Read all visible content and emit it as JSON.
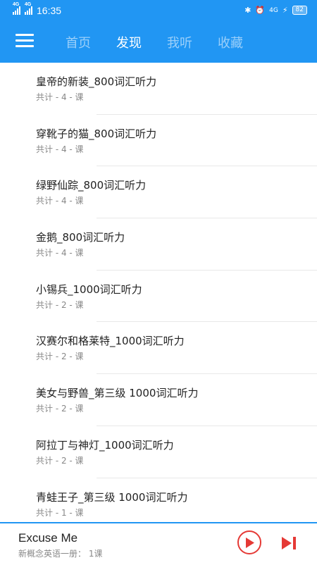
{
  "status_bar": {
    "signal1": "4G",
    "signal2": "4G",
    "time": "16:35",
    "right_network": "4G",
    "battery": "82"
  },
  "nav": {
    "tabs": [
      {
        "label": "首页",
        "active": false
      },
      {
        "label": "发现",
        "active": true
      },
      {
        "label": "我听",
        "active": false
      },
      {
        "label": "收藏",
        "active": false
      }
    ]
  },
  "list": {
    "items": [
      {
        "title": "皇帝的新装_800词汇听力",
        "subtitle": "共计 - 4 - 课"
      },
      {
        "title": "穿靴子的猫_800词汇听力",
        "subtitle": "共计 - 4 - 课"
      },
      {
        "title": "绿野仙踪_800词汇听力",
        "subtitle": "共计 - 4 - 课"
      },
      {
        "title": "金鹅_800词汇听力",
        "subtitle": "共计 - 4 - 课"
      },
      {
        "title": "小锡兵_1000词汇听力",
        "subtitle": "共计 - 2 - 课"
      },
      {
        "title": "汉赛尔和格莱特_1000词汇听力",
        "subtitle": "共计 - 2 - 课"
      },
      {
        "title": "美女与野兽_第三级 1000词汇听力",
        "subtitle": "共计 - 2 - 课"
      },
      {
        "title": "阿拉丁与神灯_1000词汇听力",
        "subtitle": "共计 - 2 - 课"
      },
      {
        "title": "青蛙王子_第三级 1000词汇听力",
        "subtitle": "共计 - 1 - 课"
      }
    ]
  },
  "player": {
    "song_title": "Excuse Me",
    "song_meta": "新概念英语一册：  1课"
  },
  "colors": {
    "primary": "#2196f3",
    "play_accent": "#e53935"
  }
}
